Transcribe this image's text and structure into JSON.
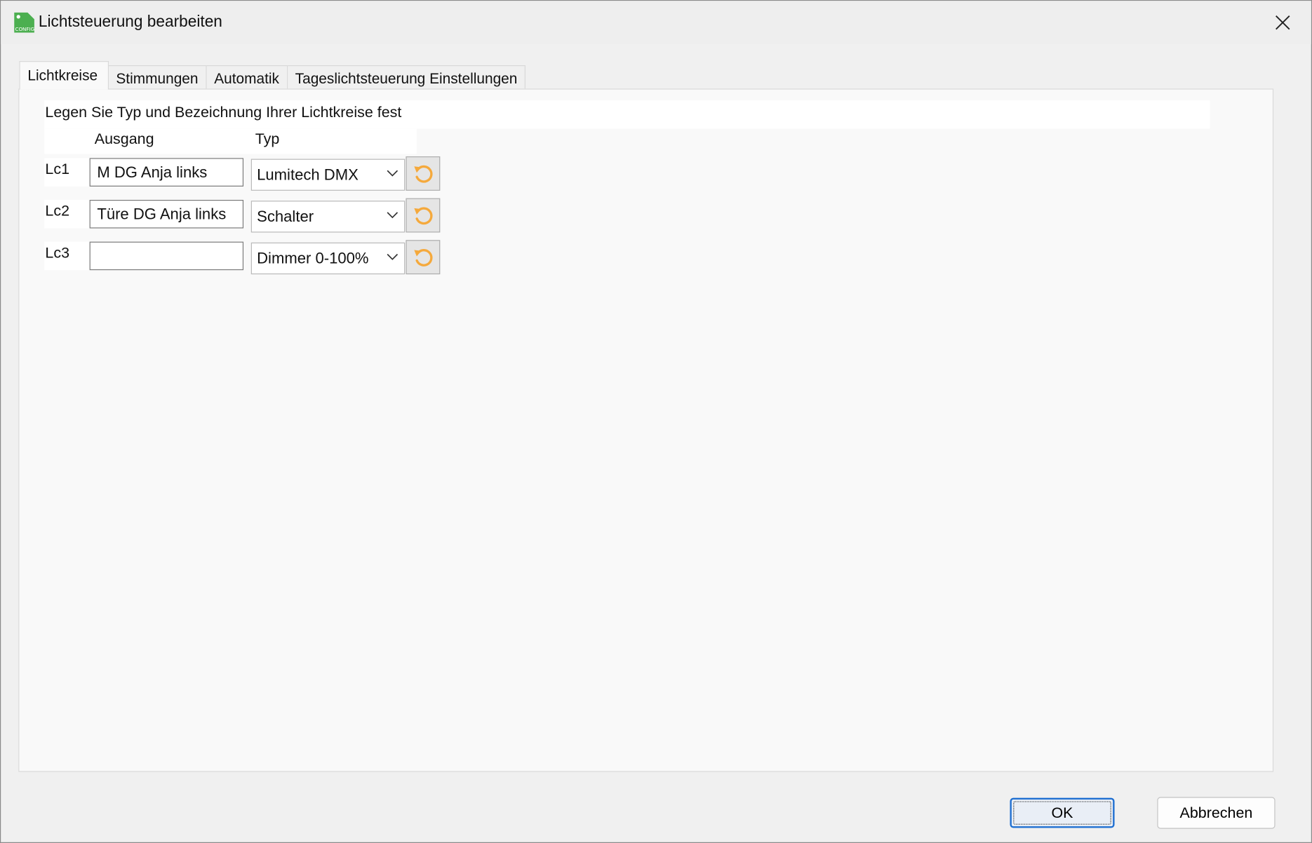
{
  "window": {
    "title": "Lichtsteuerung bearbeiten",
    "icon": "config-icon",
    "icon_text": "CONFIG"
  },
  "tabs": [
    {
      "label": "Lichtkreise",
      "active": true
    },
    {
      "label": "Stimmungen",
      "active": false
    },
    {
      "label": "Automatik",
      "active": false
    },
    {
      "label": "Tageslichtsteuerung Einstellungen",
      "active": false
    }
  ],
  "panel": {
    "intro": "Legen Sie Typ und Bezeichnung Ihrer Lichtkreise fest",
    "headers": {
      "ausgang": "Ausgang",
      "typ": "Typ"
    },
    "rows": [
      {
        "label": "Lc1",
        "output": "M DG Anja links",
        "type": "Lumitech DMX"
      },
      {
        "label": "Lc2",
        "output": "Türe DG Anja links",
        "type": "Schalter"
      },
      {
        "label": "Lc3",
        "output": "",
        "type": "Dimmer 0-100%"
      }
    ]
  },
  "buttons": {
    "ok": "OK",
    "cancel": "Abbrechen"
  },
  "colors": {
    "reset_icon": "#f5a93c",
    "focus_border": "#1f6fd1",
    "icon_green": "#4caf50"
  }
}
